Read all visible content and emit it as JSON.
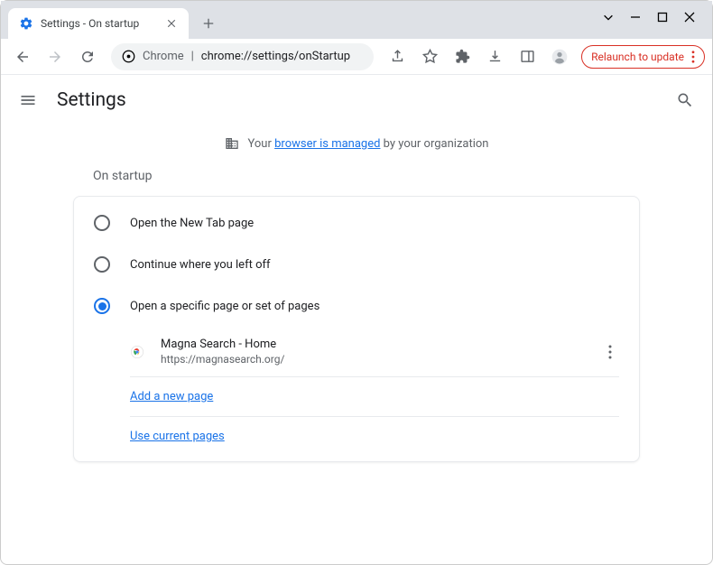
{
  "tab": {
    "title": "Settings - On startup"
  },
  "omnibox": {
    "scheme": "Chrome",
    "url": "chrome://settings/onStartup"
  },
  "toolbar": {
    "relaunch": "Relaunch to update"
  },
  "header": {
    "title": "Settings"
  },
  "banner": {
    "prefix": "Your ",
    "link": "browser is managed",
    "suffix": " by your organization"
  },
  "section": {
    "title": "On startup"
  },
  "options": {
    "newtab": "Open the New Tab page",
    "continue": "Continue where you left off",
    "specific": "Open a specific page or set of pages"
  },
  "pages": [
    {
      "name": "Magna Search - Home",
      "url": "https://magnasearch.org/"
    }
  ],
  "links": {
    "add": "Add a new page",
    "current": "Use current pages"
  }
}
